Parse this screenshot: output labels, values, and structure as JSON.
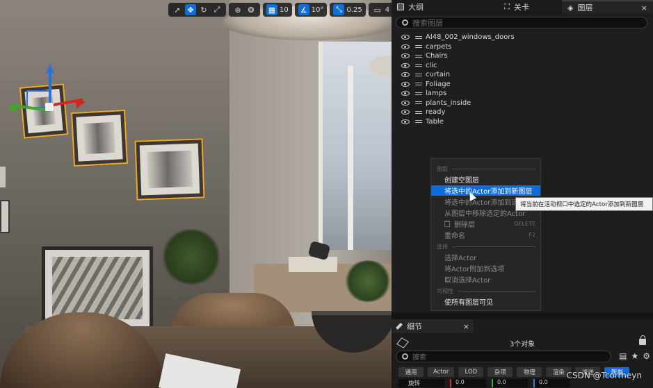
{
  "viewport_toolbar": {
    "grid_snap": "10",
    "rotation_snap": "10°",
    "scale_snap": "0.25",
    "camera_speed": "4"
  },
  "tabs": {
    "outliner": "大纲",
    "level": "关卡",
    "layers": "图层",
    "close": "×"
  },
  "layers": {
    "search_placeholder": "搜索图层",
    "items": [
      "AI48_002_windows_doors",
      "carpets",
      "Chairs",
      "clic",
      "curtain",
      "Foliage",
      "lamps",
      "plants_inside",
      "ready",
      "Table"
    ]
  },
  "context_menu": {
    "section_layers": "图层",
    "create_empty": "创建空图层",
    "add_selected_new": "将选中的Actor添加到新图层",
    "add_selected_to": "将选中的Actor添加到选",
    "remove_selected": "从图层中移除选定的Actor",
    "delete_layer": "删除层",
    "delete_shortcut": "DELETE",
    "rename": "重命名",
    "rename_shortcut": "F2",
    "section_select": "选择",
    "select_actor": "选择Actor",
    "append_actor": "将Actor附加到选项",
    "deselect_actor": "取消选择Actor",
    "section_visibility": "可视性",
    "make_all_visible": "使所有图层可见"
  },
  "tooltip": "将当前在活动视口中选定的Actor添加到新图层",
  "details": {
    "tab": "细节",
    "close": "×",
    "count": "3个对象",
    "search_placeholder": "搜索",
    "categories": [
      "通用",
      "Actor",
      "LOD",
      "杂项",
      "物理",
      "渲染",
      "流送",
      "所有"
    ],
    "active_category": "所有",
    "transform_label": "旋转",
    "values": [
      "0.0",
      "0.0",
      "0.0"
    ]
  },
  "watermark": "CSDN @Tcorrheyn"
}
